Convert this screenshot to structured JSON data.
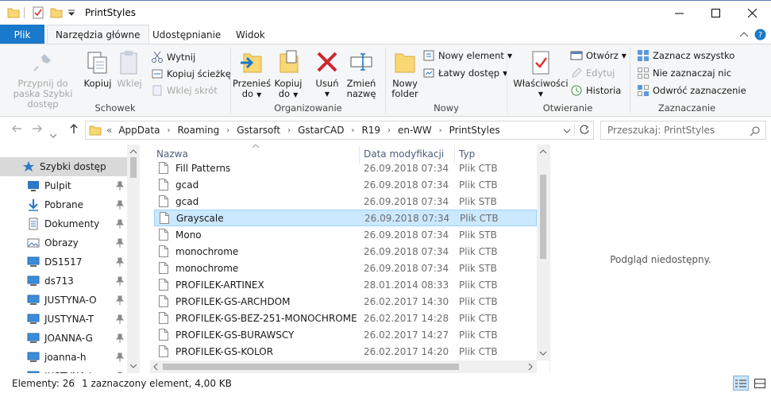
{
  "window": {
    "title": "PrintStyles"
  },
  "tabs": {
    "file": "Plik",
    "home": "Narzędzia główne",
    "share": "Udostępnianie",
    "view": "Widok"
  },
  "ribbon": {
    "clipboard": {
      "label": "Schowek",
      "pin": "Przypnij do paska Szybki dostęp",
      "copy": "Kopiuj",
      "paste": "Wklej",
      "cut": "Wytnij",
      "copy_path": "Kopiuj ścieżkę",
      "paste_shortcut": "Wklej skrót"
    },
    "organize": {
      "label": "Organizowanie",
      "move_to_1": "Przenieś",
      "move_to_2": "do",
      "copy_to_1": "Kopiuj",
      "copy_to_2": "do",
      "delete": "Usuń",
      "rename_1": "Zmień",
      "rename_2": "nazwę"
    },
    "new": {
      "label": "Nowy",
      "new_folder_1": "Nowy",
      "new_folder_2": "folder",
      "new_item": "Nowy element",
      "easy_access": "Łatwy dostęp"
    },
    "open": {
      "label": "Otwieranie",
      "properties": "Właściwości",
      "open": "Otwórz",
      "edit": "Edytuj",
      "history": "Historia"
    },
    "select": {
      "label": "Zaznaczanie",
      "select_all": "Zaznacz wszystko",
      "select_none": "Nie zaznaczaj nic",
      "invert": "Odwróć zaznaczenie"
    }
  },
  "address": {
    "prefix": "«",
    "crumbs": [
      "AppData",
      "Roaming",
      "Gstarsoft",
      "GstarCAD",
      "R19",
      "en-WW",
      "PrintStyles"
    ]
  },
  "search": {
    "placeholder": "Przeszukaj: PrintStyles"
  },
  "nav_pane": {
    "items": [
      {
        "label": "Szybki dostęp",
        "icon": "star-icon"
      },
      {
        "label": "Pulpit",
        "icon": "desktop-icon"
      },
      {
        "label": "Pobrane",
        "icon": "download-icon"
      },
      {
        "label": "Dokumenty",
        "icon": "documents-icon"
      },
      {
        "label": "Obrazy",
        "icon": "pictures-icon"
      },
      {
        "label": "DS1517",
        "icon": "monitor-icon"
      },
      {
        "label": "ds713",
        "icon": "monitor-icon"
      },
      {
        "label": "JUSTYNA-O",
        "icon": "monitor-icon"
      },
      {
        "label": "JUSTYNA-T",
        "icon": "monitor-icon"
      },
      {
        "label": "JOANNA-G",
        "icon": "monitor-icon"
      },
      {
        "label": "joanna-h",
        "icon": "monitor-icon"
      },
      {
        "label": "JUSTYNA-L",
        "icon": "monitor-icon"
      }
    ]
  },
  "file_list": {
    "columns": {
      "name": "Nazwa",
      "date": "Data modyfikacji",
      "type": "Typ"
    },
    "rows": [
      {
        "name": "Fill Patterns",
        "date": "26.09.2018 07:34",
        "type": "Plik CTB"
      },
      {
        "name": "gcad",
        "date": "26.09.2018 07:34",
        "type": "Plik CTB"
      },
      {
        "name": "gcad",
        "date": "26.09.2018 07:34",
        "type": "Plik STB"
      },
      {
        "name": "Grayscale",
        "date": "26.09.2018 07:34",
        "type": "Plik CTB"
      },
      {
        "name": "Mono",
        "date": "26.09.2018 07:34",
        "type": "Plik STB"
      },
      {
        "name": "monochrome",
        "date": "26.09.2018 07:34",
        "type": "Plik CTB"
      },
      {
        "name": "monochrome",
        "date": "26.09.2018 07:34",
        "type": "Plik STB"
      },
      {
        "name": "PROFILEK-ARTINEX",
        "date": "28.01.2014 08:33",
        "type": "Plik CTB"
      },
      {
        "name": "PROFILEK-GS-ARCHDOM",
        "date": "26.02.2017 14:30",
        "type": "Plik CTB"
      },
      {
        "name": "PROFILEK-GS-BEZ-251-MONOCHROME",
        "date": "26.02.2017 14:28",
        "type": "Plik CTB"
      },
      {
        "name": "PROFILEK-GS-BURAWSCY",
        "date": "26.02.2017 14:27",
        "type": "Plik CTB"
      },
      {
        "name": "PROFILEK-GS-KOLOR",
        "date": "26.02.2017 14:20",
        "type": "Plik CTB"
      }
    ]
  },
  "preview": {
    "text": "Podgląd niedostępny."
  },
  "status": {
    "count": "Elementy: 26",
    "selection": "1 zaznaczony element, 4,00 KB"
  }
}
